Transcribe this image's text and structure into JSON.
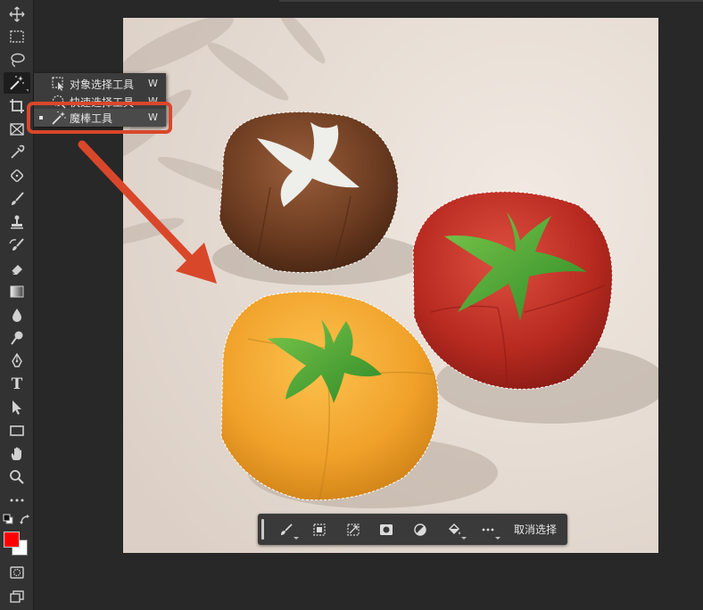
{
  "flyout": {
    "items": [
      {
        "label": "对象选择工具",
        "shortcut": "W"
      },
      {
        "label": "快速选择工具",
        "shortcut": "W"
      },
      {
        "label": "魔棒工具",
        "shortcut": "W"
      }
    ]
  },
  "contextbar": {
    "deselect_label": "取消选择"
  },
  "colors": {
    "foreground": "#ff0000",
    "background": "#ffffff",
    "highlight": "#d9472b",
    "toolbar": "#323232",
    "workspace": "#282828"
  },
  "icons": {
    "tools": [
      "move-icon",
      "marquee-icon",
      "lasso-icon",
      "magic-wand-icon",
      "crop-icon",
      "frame-icon",
      "eyedropper-icon",
      "healing-brush-icon",
      "brush-icon",
      "stamp-icon",
      "history-brush-icon",
      "eraser-icon",
      "gradient-icon",
      "blur-icon",
      "dodge-icon",
      "pen-icon",
      "type-icon",
      "path-selection-icon",
      "rectangle-icon",
      "hand-icon",
      "zoom-icon",
      "more-tools-icon"
    ],
    "type_tool_glyph": "T"
  }
}
